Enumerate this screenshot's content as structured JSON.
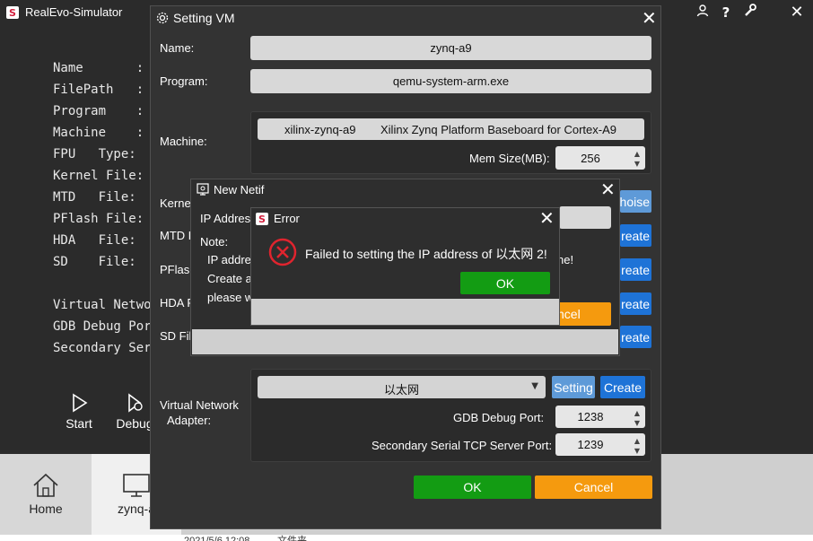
{
  "app": {
    "title": "RealEvo-Simulator",
    "logo_letter": "S",
    "titlebar_icons": [
      "user-icon",
      "help-icon",
      "wrench-icon",
      "close-icon"
    ],
    "info_rows": [
      "Name       :",
      "FilePath   :",
      "Program    :",
      "Machine    :",
      "FPU   Type:",
      "Kernel File:",
      "MTD   File:",
      "PFlash File:",
      "HDA   File:",
      "SD    File:"
    ],
    "info_rows2": [
      "Virtual Networ",
      "GDB Debug Port",
      "Secondary Seri"
    ],
    "start_label": "Start",
    "debug_label": "Debug",
    "tabs": [
      {
        "label": "Home",
        "icon": "home-icon"
      },
      {
        "label": "zynq-a",
        "icon": "monitor-icon"
      }
    ],
    "under_text": "2021/5/6 12:08          文件夹"
  },
  "setting_vm": {
    "title": "Setting VM",
    "name_label": "Name:",
    "name_value": "zynq-a9",
    "program_label": "Program:",
    "program_value": "qemu-system-arm.exe",
    "machine_label": "Machine:",
    "machine_id": "xilinx-zynq-a9",
    "machine_desc": "Xilinx Zynq Platform Baseboard for Cortex-A9",
    "mem_label": "Mem Size(MB):",
    "mem_value": "256",
    "kernel_label": "Kerne",
    "mtd_label": "MTD F",
    "pflash_label": "PFlash",
    "hda_label": "HDA F",
    "sd_label": "SD File",
    "choise_label": "hoise",
    "create_label": "reate",
    "vna_label_line1": "Virtual Network",
    "vna_label_line2": "Adapter:",
    "adapter_value": "以太网",
    "setting_btn": "Setting",
    "create_btn": "Create",
    "gdb_label": "GDB Debug Port:",
    "gdb_value": "1238",
    "serial_label": "Secondary Serial TCP Server Port:",
    "serial_value": "1239",
    "ok_label": "OK",
    "cancel_label": "Cancel"
  },
  "new_netif": {
    "title": "New Netif",
    "ip_label": "IP Addres",
    "note_label": "Note:",
    "note_line1": "IP addre",
    "note_line1_tail": "ne!",
    "note_line2": "Create a",
    "note_line3": "please w",
    "cancel_partial": "ncel"
  },
  "error": {
    "title": "Error",
    "message": "Failed to setting the IP address of 以太网 2!",
    "ok_label": "OK"
  },
  "colors": {
    "window_bg": "#2b2b2b",
    "dialog_bg": "#333333",
    "blue": "#1e73d7",
    "green": "#139c13",
    "orange": "#f59a0e",
    "error_red": "#e0242e"
  }
}
